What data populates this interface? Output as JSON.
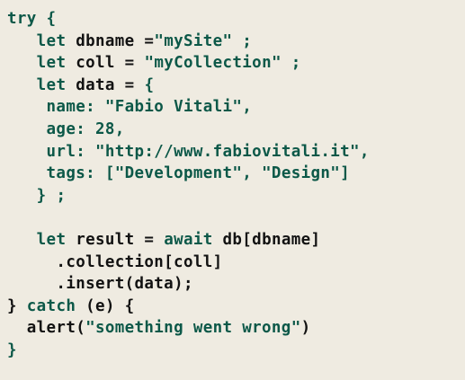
{
  "code": {
    "language": "javascript",
    "lines": [
      [
        {
          "t": "try {",
          "c": "kw"
        }
      ],
      [
        {
          "t": "   ",
          "c": "txt"
        },
        {
          "t": "let",
          "c": "kw"
        },
        {
          "t": " dbname =",
          "c": "txt"
        },
        {
          "t": "\"mySite\"",
          "c": "str"
        },
        {
          "t": " ;",
          "c": "punc"
        }
      ],
      [
        {
          "t": "   ",
          "c": "txt"
        },
        {
          "t": "let",
          "c": "kw"
        },
        {
          "t": " coll = ",
          "c": "txt"
        },
        {
          "t": "\"myCollection\"",
          "c": "str"
        },
        {
          "t": " ;",
          "c": "punc"
        }
      ],
      [
        {
          "t": "   ",
          "c": "txt"
        },
        {
          "t": "let",
          "c": "kw"
        },
        {
          "t": " data = ",
          "c": "txt"
        },
        {
          "t": "{",
          "c": "punc"
        }
      ],
      [
        {
          "t": "    ",
          "c": "txt"
        },
        {
          "t": "name:",
          "c": "prop"
        },
        {
          "t": " ",
          "c": "txt"
        },
        {
          "t": "\"Fabio Vitali\",",
          "c": "str"
        }
      ],
      [
        {
          "t": "    ",
          "c": "txt"
        },
        {
          "t": "age:",
          "c": "prop"
        },
        {
          "t": " ",
          "c": "txt"
        },
        {
          "t": "28,",
          "c": "num"
        }
      ],
      [
        {
          "t": "    ",
          "c": "txt"
        },
        {
          "t": "url:",
          "c": "prop"
        },
        {
          "t": " ",
          "c": "txt"
        },
        {
          "t": "\"http://www.fabiovitali.it\",",
          "c": "str"
        }
      ],
      [
        {
          "t": "    ",
          "c": "txt"
        },
        {
          "t": "tags:",
          "c": "prop"
        },
        {
          "t": " ",
          "c": "txt"
        },
        {
          "t": "[\"Development\", \"Design\"]",
          "c": "str"
        }
      ],
      [
        {
          "t": "   ",
          "c": "txt"
        },
        {
          "t": "} ;",
          "c": "punc"
        }
      ],
      [
        {
          "t": "",
          "c": "txt"
        }
      ],
      [
        {
          "t": "   ",
          "c": "txt"
        },
        {
          "t": "let",
          "c": "kw"
        },
        {
          "t": " result = ",
          "c": "txt"
        },
        {
          "t": "await",
          "c": "kw"
        },
        {
          "t": " db[dbname]",
          "c": "txt"
        }
      ],
      [
        {
          "t": "     .collection[coll]",
          "c": "txt"
        }
      ],
      [
        {
          "t": "     .insert(data);",
          "c": "txt"
        }
      ],
      [
        {
          "t": "} ",
          "c": "txt"
        },
        {
          "t": "catch",
          "c": "kw"
        },
        {
          "t": " (e) {",
          "c": "txt"
        }
      ],
      [
        {
          "t": "  alert(",
          "c": "txt"
        },
        {
          "t": "\"something went wrong\"",
          "c": "str"
        },
        {
          "t": ")",
          "c": "txt"
        }
      ],
      [
        {
          "t": "}",
          "c": "punc"
        }
      ]
    ]
  }
}
